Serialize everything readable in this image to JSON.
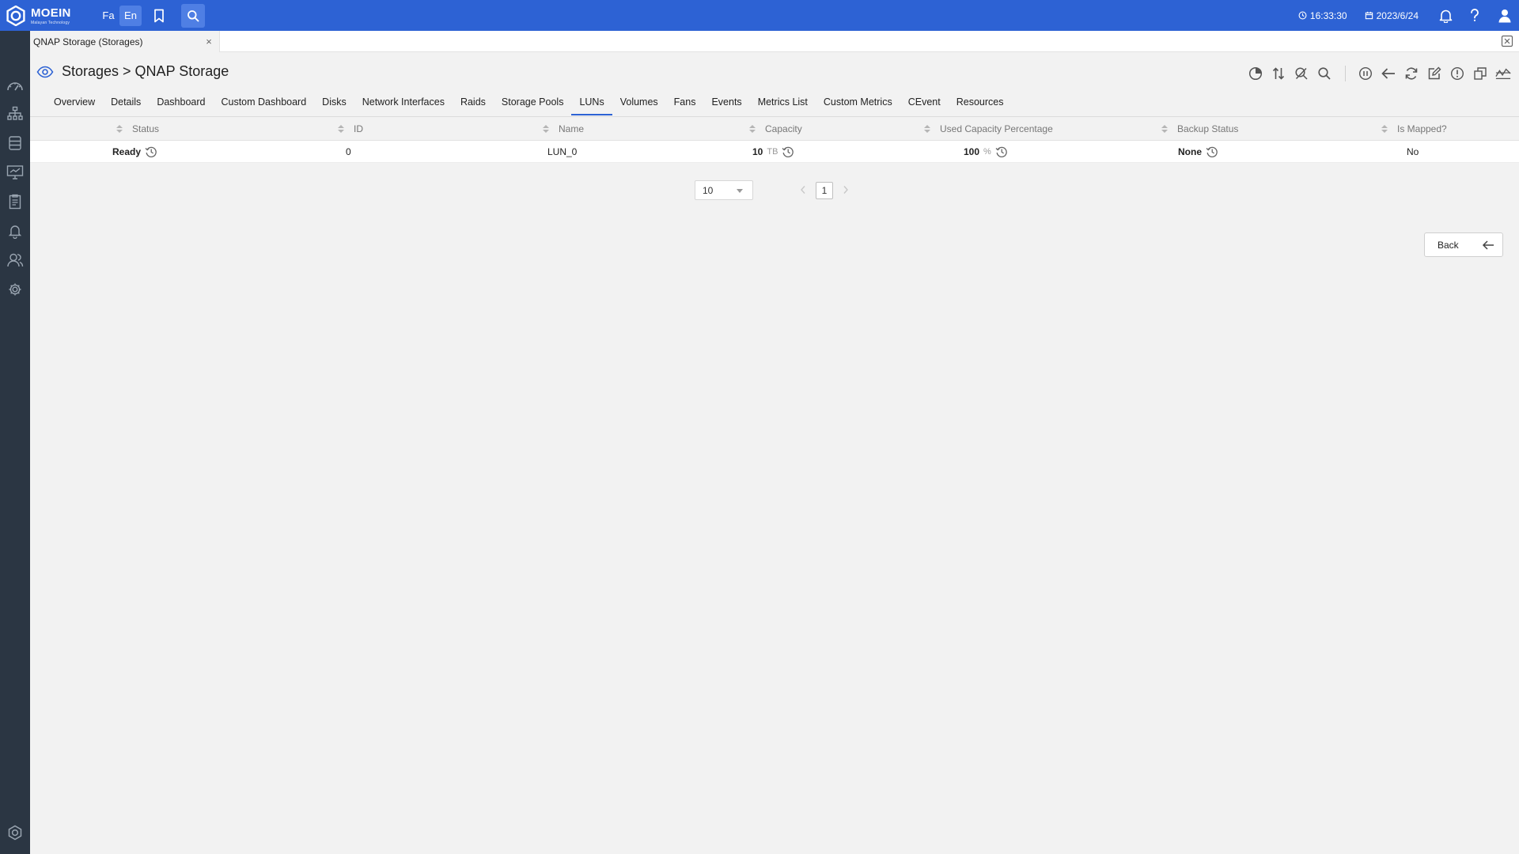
{
  "brand": {
    "name": "MOEIN",
    "tagline": "Malayan Technology"
  },
  "topbar": {
    "lang_fa": "Fa",
    "lang_en": "En",
    "time": "16:33:30",
    "date": "2023/6/24"
  },
  "doc_tab": {
    "title": "QNAP Storage (Storages)",
    "close": "×"
  },
  "page": {
    "title": "Storages > QNAP Storage"
  },
  "tabs": [
    {
      "label": "Overview"
    },
    {
      "label": "Details"
    },
    {
      "label": "Dashboard"
    },
    {
      "label": "Custom Dashboard"
    },
    {
      "label": "Disks"
    },
    {
      "label": "Network Interfaces"
    },
    {
      "label": "Raids"
    },
    {
      "label": "Storage Pools"
    },
    {
      "label": "LUNs"
    },
    {
      "label": "Volumes"
    },
    {
      "label": "Fans"
    },
    {
      "label": "Events"
    },
    {
      "label": "Metrics List"
    },
    {
      "label": "Custom Metrics"
    },
    {
      "label": "CEvent"
    },
    {
      "label": "Resources"
    }
  ],
  "active_tab": "LUNs",
  "table": {
    "columns": [
      "Status",
      "ID",
      "Name",
      "Capacity",
      "Used Capacity Percentage",
      "Backup Status",
      "Is Mapped?"
    ],
    "rows": [
      {
        "status": "Ready",
        "id": "0",
        "name": "LUN_0",
        "capacity": "10",
        "capacity_unit": "TB",
        "used_pct": "100",
        "used_pct_unit": "%",
        "backup_status": "None",
        "is_mapped": "No"
      }
    ]
  },
  "pagination": {
    "page_size": "10",
    "current_page": "1"
  },
  "back_button": {
    "label": "Back"
  },
  "colors": {
    "topbar": "#2d62d4",
    "sidebar": "#2b3643",
    "active_tab_underline": "#2d62d4"
  }
}
